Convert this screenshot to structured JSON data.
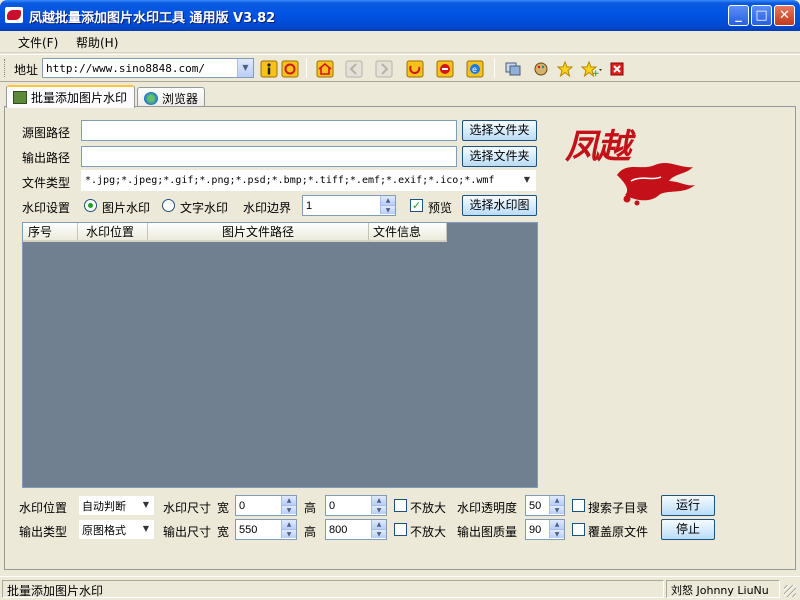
{
  "window": {
    "title": "凤越批量添加图片水印工具 通用版 V3.82",
    "min": "_",
    "max": "□",
    "close": "✕"
  },
  "menu": {
    "file": "文件(F)",
    "help": "帮助(H)"
  },
  "toolbar": {
    "address_label": "地址",
    "address_value": "http://www.sino8848.com/"
  },
  "tabs": [
    {
      "label": "批量添加图片水印"
    },
    {
      "label": "浏览器"
    }
  ],
  "form": {
    "source_label": "源图路径",
    "source_value": "",
    "output_label": "输出路径",
    "output_value": "",
    "choose_folder_label": "选择文件夹",
    "filetype_label": "文件类型",
    "filetype_value": "*.jpg;*.jpeg;*.gif;*.png;*.psd;*.bmp;*.tiff;*.emf;*.exif;*.ico;*.wmf",
    "watermark_setting_label": "水印设置",
    "radio_image": "图片水印",
    "radio_text": "文字水印",
    "border_label": "水印边界",
    "border_value": "1",
    "preview_label": "预览",
    "choose_watermark_label": "选择水印图"
  },
  "listview": {
    "columns": [
      "序号",
      "水印位置",
      "图片文件路径",
      "文件信息"
    ]
  },
  "bottom": {
    "wm_position_label": "水印位置",
    "wm_position_value": "自动判断",
    "wm_size_label": "水印尺寸",
    "width_label": "宽",
    "height_label": "高",
    "wm_width": "0",
    "wm_height": "0",
    "no_enlarge": "不放大",
    "opacity_label": "水印透明度",
    "opacity_value": "50",
    "search_subdir": "搜索子目录",
    "run": "运行",
    "output_type_label": "输出类型",
    "output_type_value": "原图格式",
    "out_size_label": "输出尺寸",
    "out_width": "550",
    "out_height": "800",
    "quality_label": "输出图质量",
    "quality_value": "90",
    "overwrite": "覆盖原文件",
    "stop": "停止"
  },
  "logo": {
    "text": "凤越"
  },
  "status": {
    "left": "批量添加图片水印",
    "right": "刘怒 Johnny LiuNu"
  }
}
